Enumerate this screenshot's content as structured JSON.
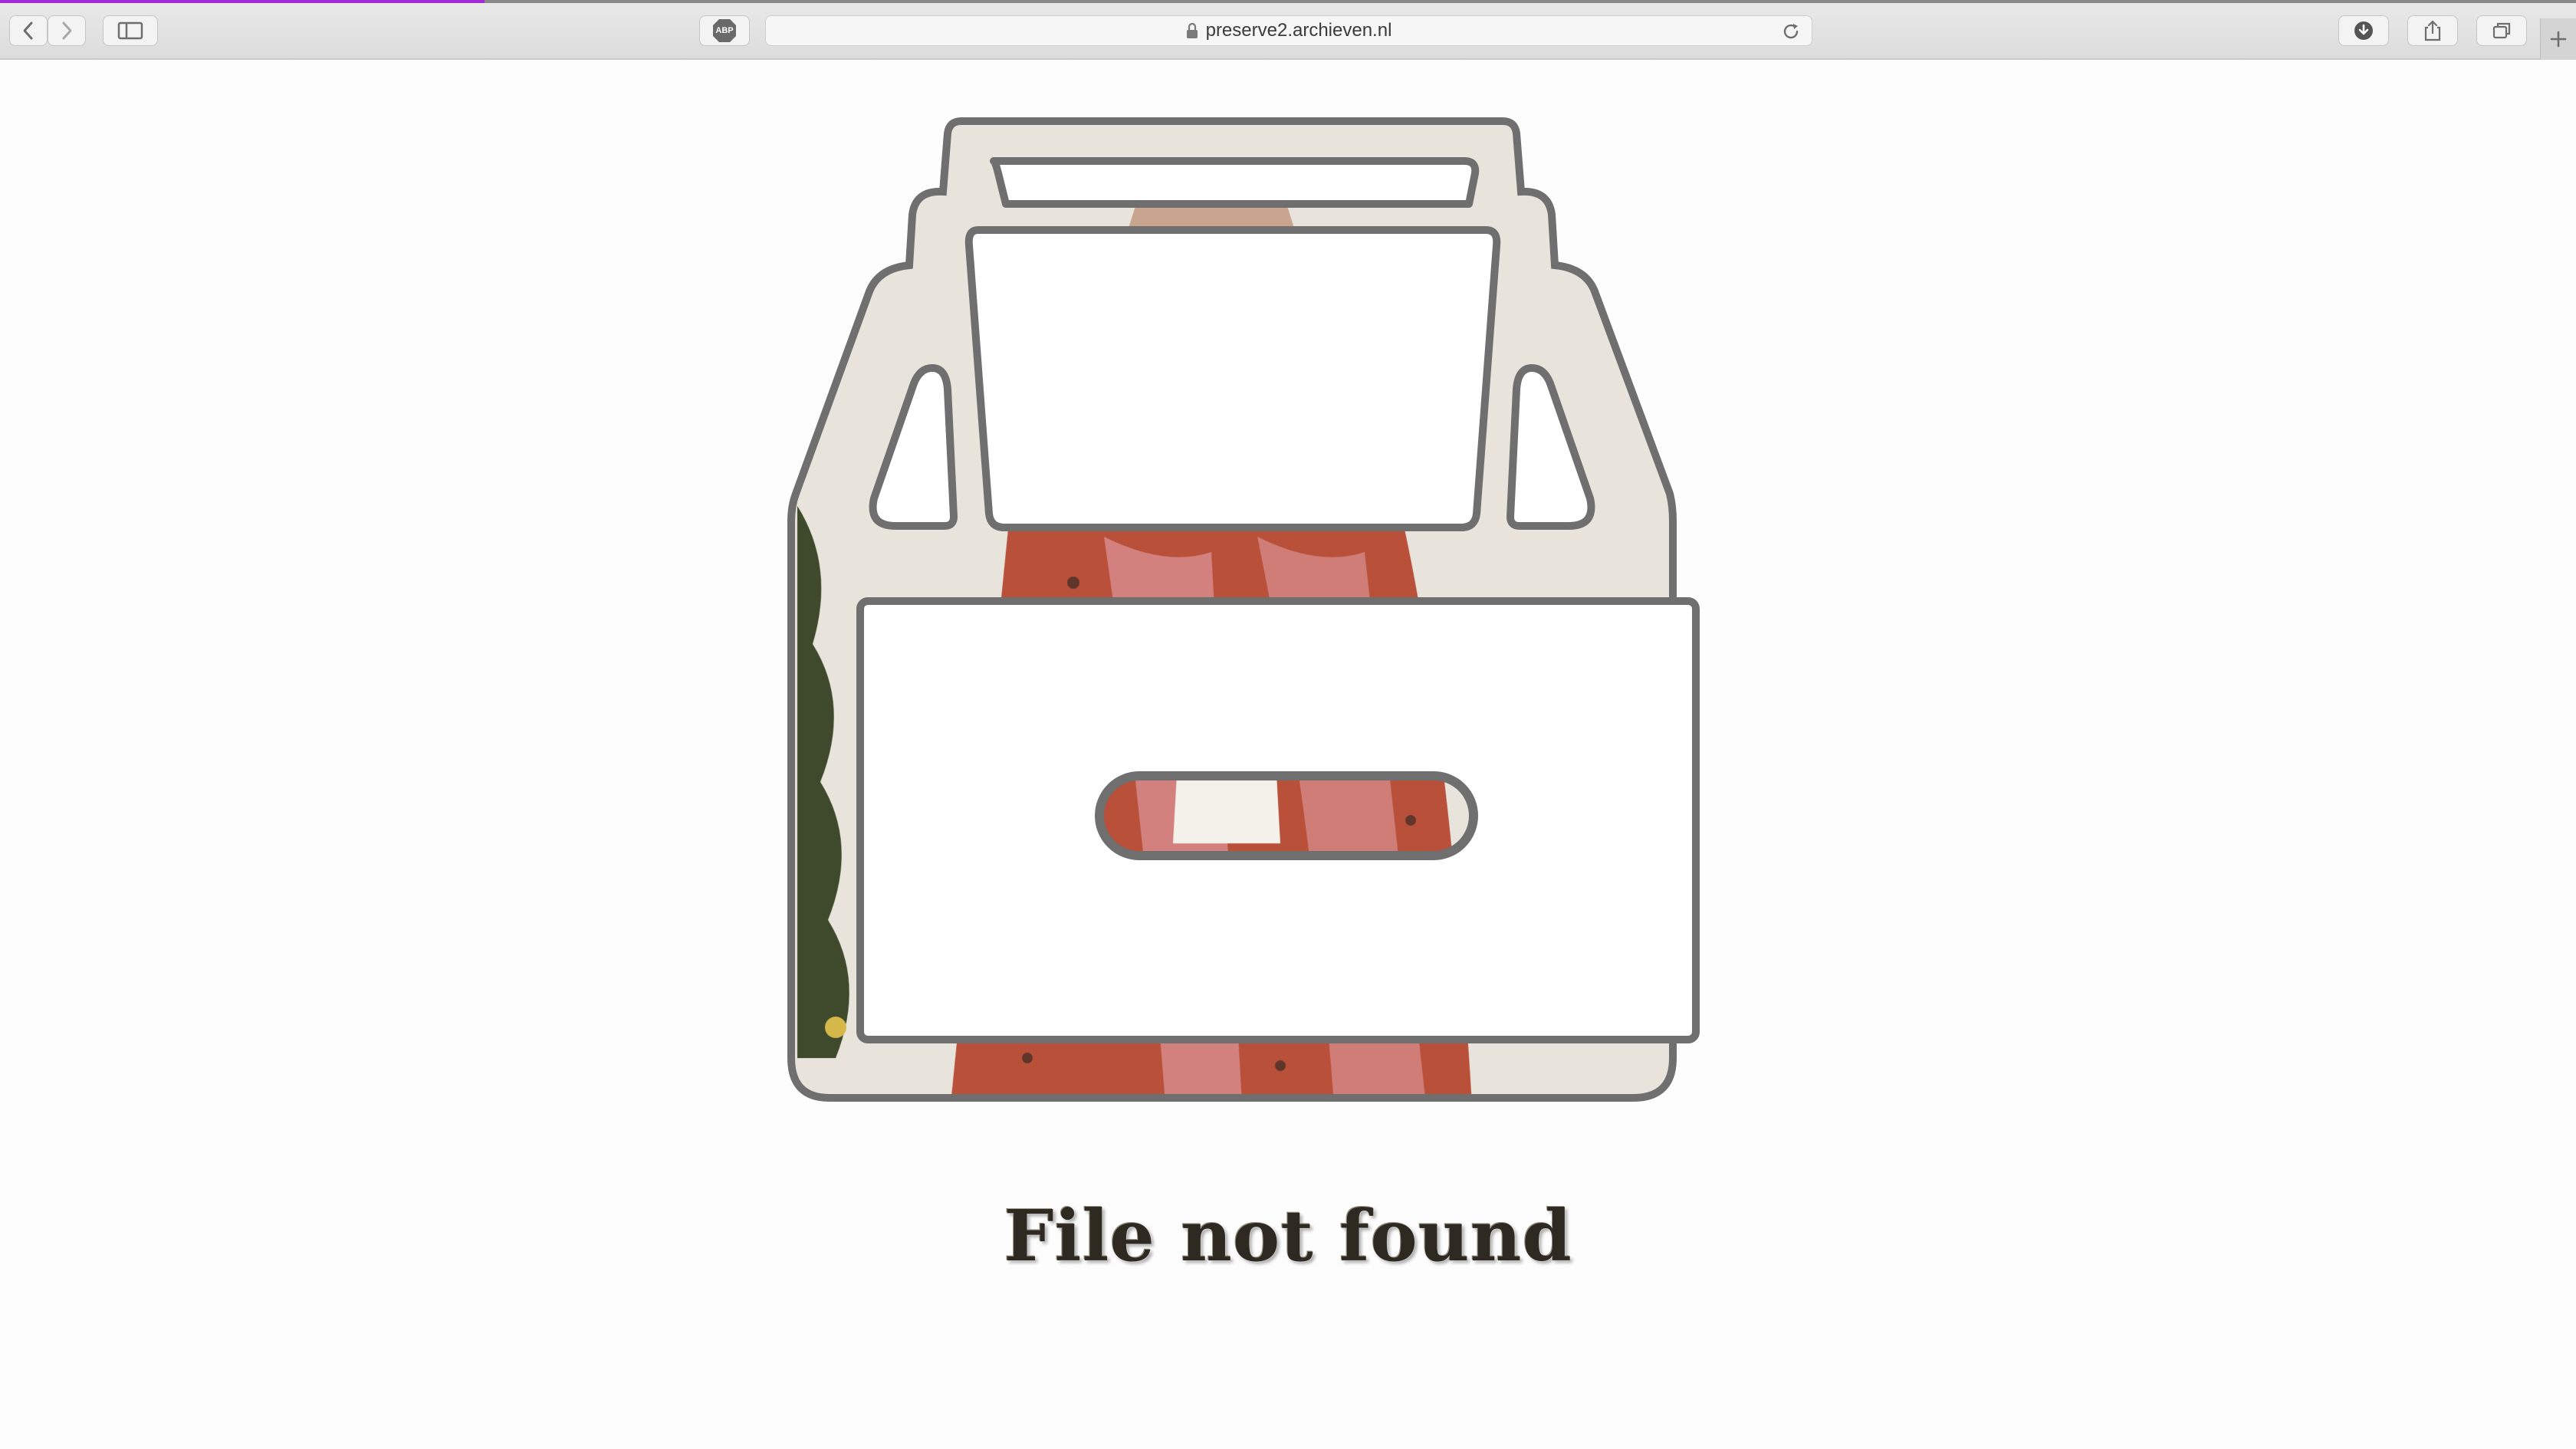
{
  "browser": {
    "url": "preserve2.archieven.nl",
    "extension_badge": "ABP",
    "icons": {
      "back": "chevron-left-icon",
      "forward": "chevron-right-icon",
      "sidebar": "sidebar-icon",
      "lock": "lock-icon",
      "reload": "reload-icon",
      "downloads": "download-icon",
      "share": "share-icon",
      "tabs": "tab-overview-icon",
      "new_tab": "plus-icon"
    },
    "colors": {
      "tab_accent": "#a22ad8"
    }
  },
  "page": {
    "title": "File not found",
    "illustration": "archive-box-icon"
  }
}
